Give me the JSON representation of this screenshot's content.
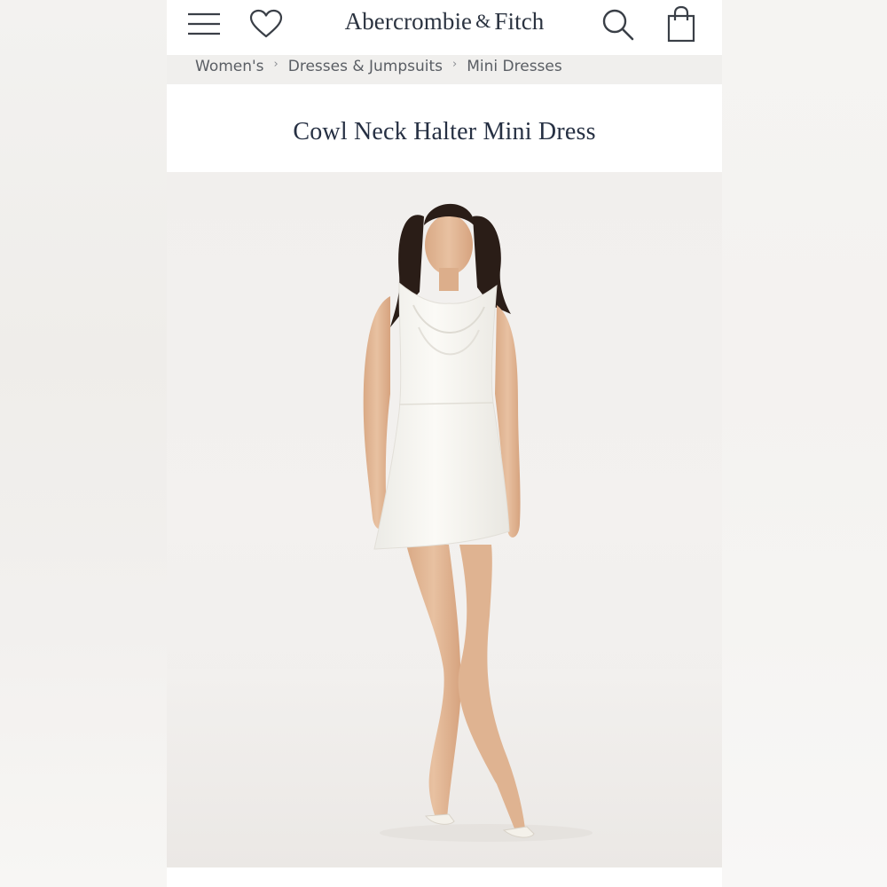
{
  "header": {
    "brand_name": "Abercrombie",
    "brand_amp": "&",
    "brand_name_2": "Fitch",
    "icons": {
      "menu": "hamburger-menu-icon",
      "favorites": "heart-icon",
      "search": "search-icon",
      "bag": "shopping-bag-icon"
    }
  },
  "breadcrumb": {
    "items": [
      {
        "label": "Women's"
      },
      {
        "label": "Dresses & Jumpsuits"
      },
      {
        "label": "Mini Dresses"
      }
    ],
    "separator": "›"
  },
  "product": {
    "title": "Cowl Neck Halter Mini Dress"
  },
  "colors": {
    "brand_text": "#2b3340",
    "title_text": "#263043",
    "breadcrumb_bg": "#f0efed",
    "dress": "#f7f5f0",
    "skin": "#e3b896",
    "hair": "#2a1d17"
  }
}
